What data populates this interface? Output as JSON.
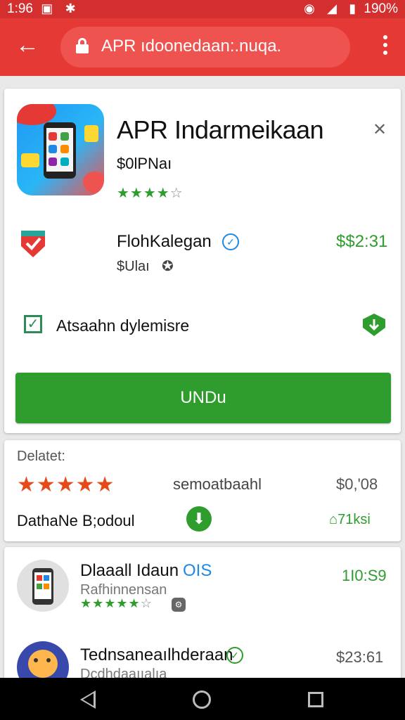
{
  "status": {
    "time": "1:96",
    "battery": "190%"
  },
  "browser": {
    "url": "APR ıdoonedaan:.nuqa."
  },
  "app": {
    "title": "APR Indarmeikaan",
    "developer": "$0lPNaı",
    "rating_stars": 4,
    "rating_max": 5
  },
  "seller": {
    "name": "FlohKalegan",
    "sub": "$Ulaı",
    "price": "$$2:31"
  },
  "option": {
    "label": "Atsaahn dylemisre"
  },
  "install_label": "UNDu",
  "details": {
    "heading": "Delatet:",
    "stars": 5,
    "middle_text": "semoatbaahl",
    "price": "$0,'08",
    "download_label": "DathaNe B;odoul",
    "download_count": "71ksi"
  },
  "list": [
    {
      "title": "Dlaaall Idaun",
      "title_badge": "OIS",
      "subtitle": "Rafhinnensan",
      "stars": 5,
      "price": "1I0:S9"
    },
    {
      "title": "Tednsaneaılhderaan",
      "subtitle": "Dcdhdaaııalıa",
      "price": "$23:61"
    }
  ],
  "colors": {
    "accent": "#e53935",
    "green": "#2e9d2e",
    "orange": "#e64a19"
  }
}
